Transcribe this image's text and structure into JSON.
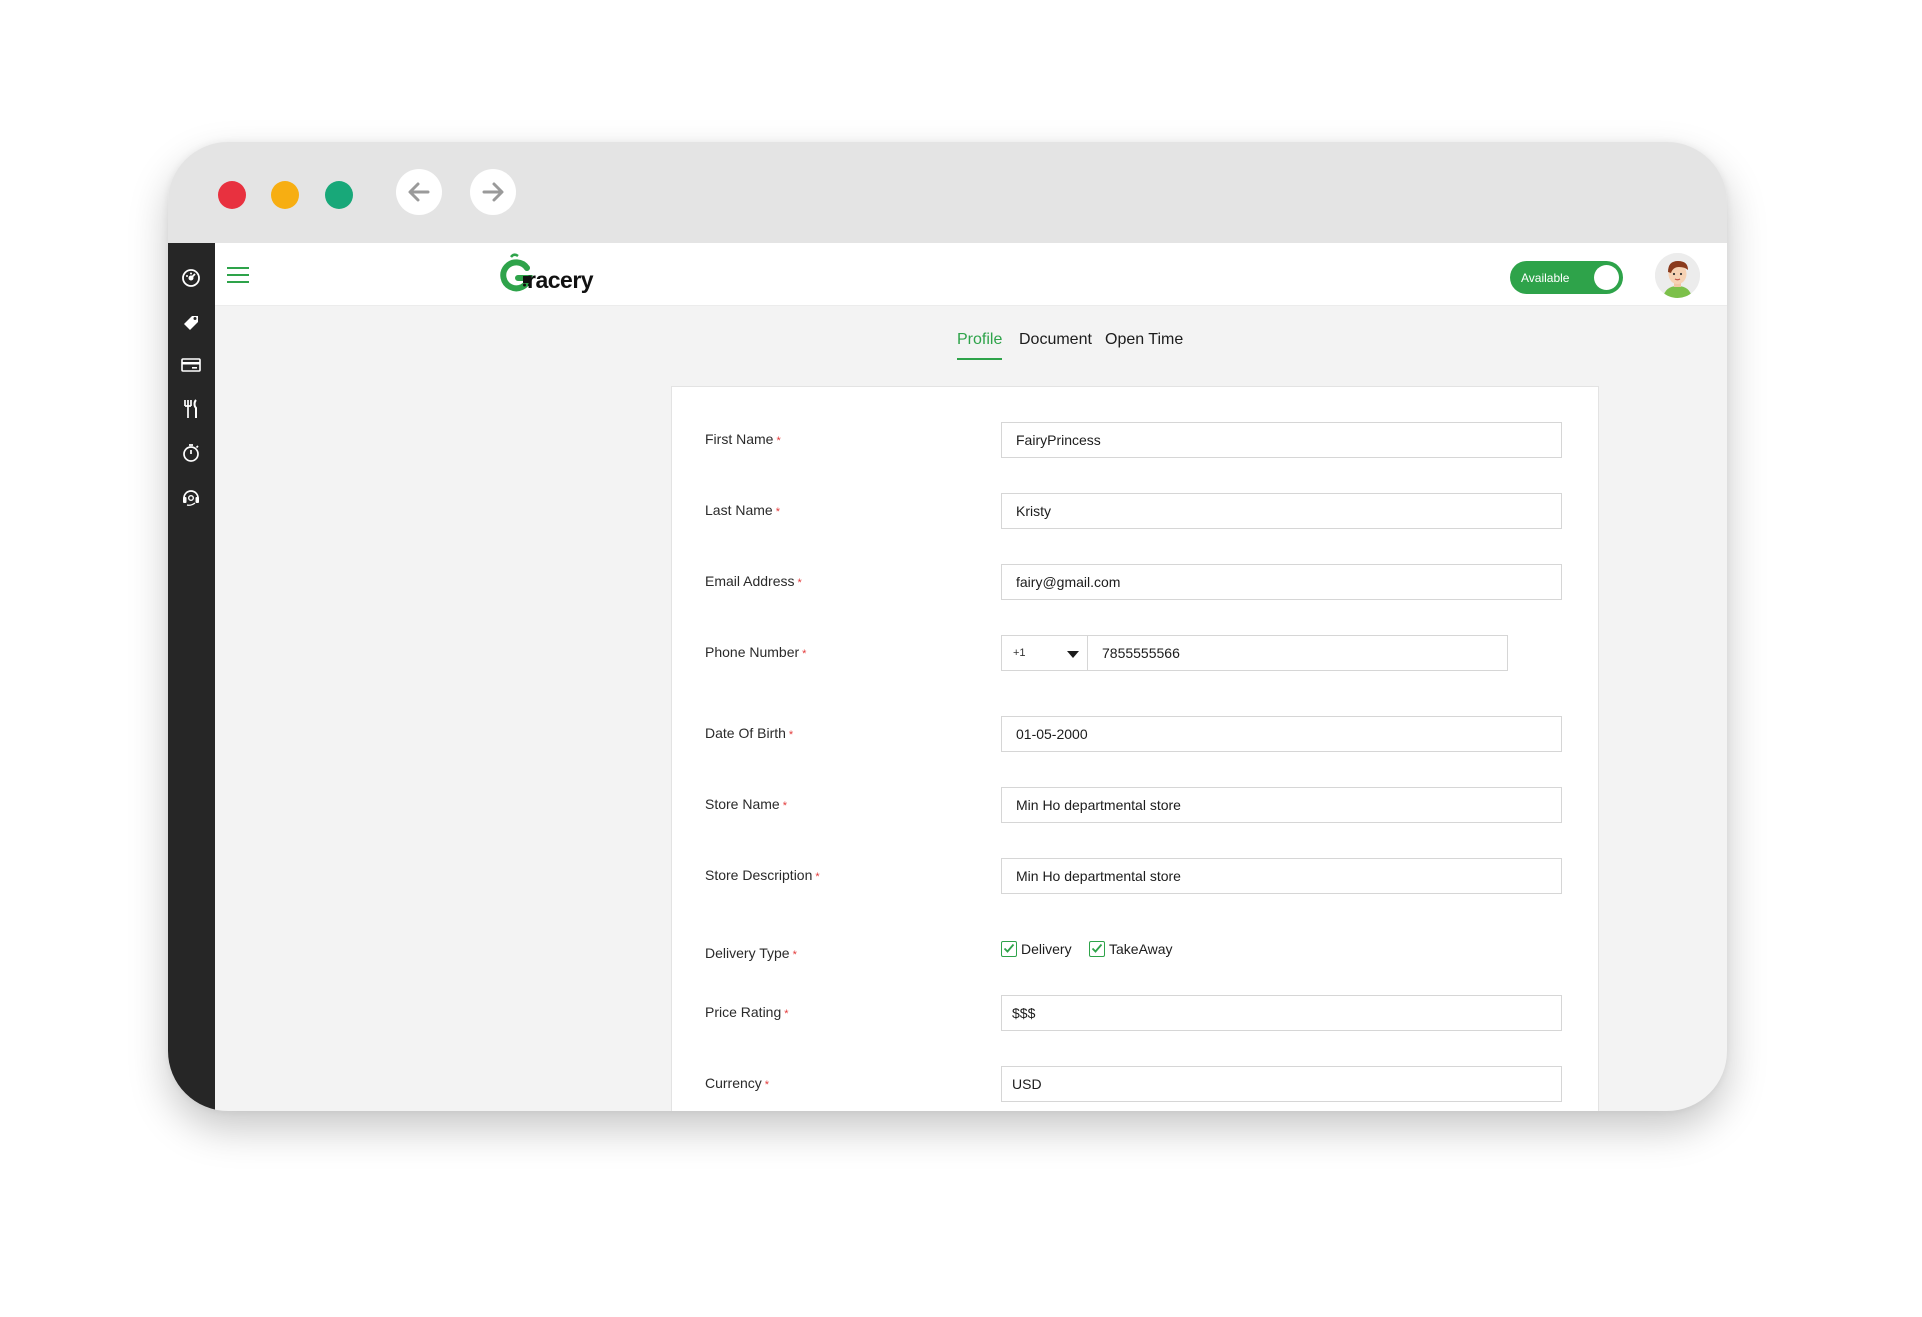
{
  "app": {
    "brand_logo_text": "Grocery",
    "availability_label": "Available",
    "accent_color": "#2ea34a"
  },
  "sidebar": {
    "icons": [
      "dashboard-icon",
      "tag-icon",
      "card-icon",
      "fork-knife-icon",
      "timer-icon",
      "support-icon"
    ]
  },
  "tabs": [
    {
      "label": "Profile",
      "active": true
    },
    {
      "label": "Document",
      "active": false
    },
    {
      "label": "Open Time",
      "active": false
    }
  ],
  "form": {
    "required_marker": "*",
    "first_name": {
      "label": "First Name",
      "value": "FairyPrincess"
    },
    "last_name": {
      "label": "Last Name",
      "value": "Kristy"
    },
    "email": {
      "label": "Email Address",
      "value": "fairy@gmail.com"
    },
    "phone": {
      "label": "Phone Number",
      "code": "+1",
      "value": "7855555566"
    },
    "dob": {
      "label": "Date Of Birth",
      "value": "01-05-2000"
    },
    "store_name": {
      "label": "Store Name",
      "value": "Min Ho departmental store"
    },
    "store_description": {
      "label": "Store Description",
      "value": "Min Ho departmental store"
    },
    "delivery_type": {
      "label": "Delivery Type",
      "options": [
        {
          "label": "Delivery",
          "checked": true
        },
        {
          "label": "TakeAway",
          "checked": true
        }
      ]
    },
    "price_rating": {
      "label": "Price Rating",
      "value": "$$$"
    },
    "currency": {
      "label": "Currency",
      "value": "USD"
    }
  }
}
